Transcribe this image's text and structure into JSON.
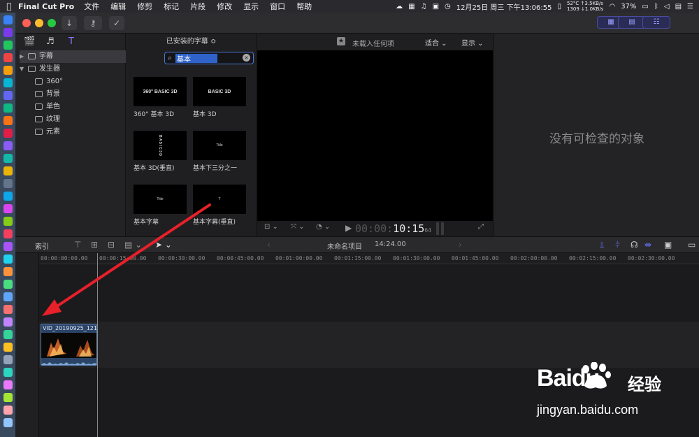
{
  "menubar": {
    "app_name": "Final Cut Pro",
    "menus": [
      "文件",
      "编辑",
      "修剪",
      "标记",
      "片段",
      "修改",
      "显示",
      "窗口",
      "帮助"
    ],
    "stats_top": "52°C  ↑3.5KB/s",
    "stats_bottom": "1309  ↓1.0KB/s",
    "battery": "37%",
    "datetime": "12月25日 周三 下午13:06:55"
  },
  "browser": {
    "tree": [
      {
        "label": "字幕",
        "level": 0,
        "expanded": false,
        "selected": true
      },
      {
        "label": "发生器",
        "level": 0,
        "expanded": true,
        "selected": false
      },
      {
        "label": "360°",
        "level": 1
      },
      {
        "label": "背景",
        "level": 1
      },
      {
        "label": "单色",
        "level": 1
      },
      {
        "label": "纹理",
        "level": 1
      },
      {
        "label": "元素",
        "level": 1
      }
    ],
    "header": "已安装的字幕 ≎",
    "search_value": "基本",
    "titles": [
      {
        "thumb": "360° BASIC 3D",
        "label": "360° 基本 3D"
      },
      {
        "thumb": "BASIC 3D",
        "label": "基本 3D"
      },
      {
        "thumb": "B A S I C 3 D",
        "label": "基本 3D(垂直)"
      },
      {
        "thumb": "Title",
        "label": "基本下三分之一"
      },
      {
        "thumb": "Title",
        "label": "基本字幕"
      },
      {
        "thumb": "T",
        "label": "基本字幕(垂直)"
      }
    ]
  },
  "viewer": {
    "status": "未载入任何项",
    "fit_label": "适合 ⌄",
    "display_label": "显示 ⌄",
    "timecode_dim": "00:00:",
    "timecode_lit": "10:15",
    "timecode_frames": "64"
  },
  "inspector": {
    "empty_message": "没有可检查的对象"
  },
  "timeline_toolbar": {
    "index_label": "索引",
    "project_name": "未命名项目",
    "duration": "14:24.00"
  },
  "timeline": {
    "ruler_ticks": [
      "00:00:00:00.00",
      "00:00:15:00.00",
      "00:00:30:00.00",
      "00:00:45:00.00",
      "00:01:00:00.00",
      "00:01:15:00.00",
      "00:01:30:00.00",
      "00:01:45:00.00",
      "00:02:00:00.00",
      "00:02:15:00.00",
      "00:02:30:00.00"
    ],
    "clip_name": "VID_20190925_121..."
  },
  "watermark": {
    "brand": "Baidu",
    "sub": "经验",
    "url": "jingyan.baidu.com"
  },
  "colors": {
    "accent_blue": "#4a79d8",
    "annotation_red": "#e8202a",
    "clip_blue": "#2b4466"
  }
}
